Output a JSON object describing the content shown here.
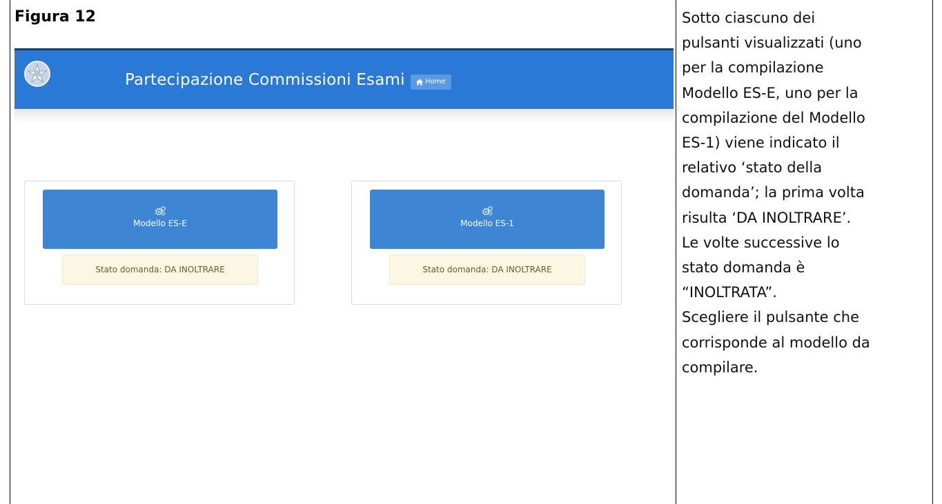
{
  "figure": {
    "title": "Figura 12"
  },
  "app": {
    "title": "Partecipazione Commissioni Esami",
    "home_label": "Home",
    "header_color": "#2a79d6",
    "icons": {
      "emblem": "italian-republic-emblem",
      "home": "home-icon",
      "cogs": "cogs-icon"
    }
  },
  "cards": [
    {
      "label": "Modello ES-E",
      "status": "Stato domanda: DA INOLTRARE"
    },
    {
      "label": "Modello ES-1",
      "status": "Stato domanda: DA INOLTRARE"
    }
  ],
  "explanation": {
    "lines": [
      "Sotto ciascuno dei",
      "pulsanti visualizzati (uno",
      "per la compilazione",
      "Modello ES-E, uno per la",
      "compilazione del Modello",
      "ES-1) viene indicato il",
      "relativo ‘stato della",
      "domanda’; la prima volta",
      "risulta ‘DA INOLTRARE’.",
      "Le volte successive lo",
      "stato domanda è",
      "“INOLTRATA”.",
      "Scegliere il pulsante che",
      "corrisponde al modello da",
      "compilare."
    ]
  }
}
